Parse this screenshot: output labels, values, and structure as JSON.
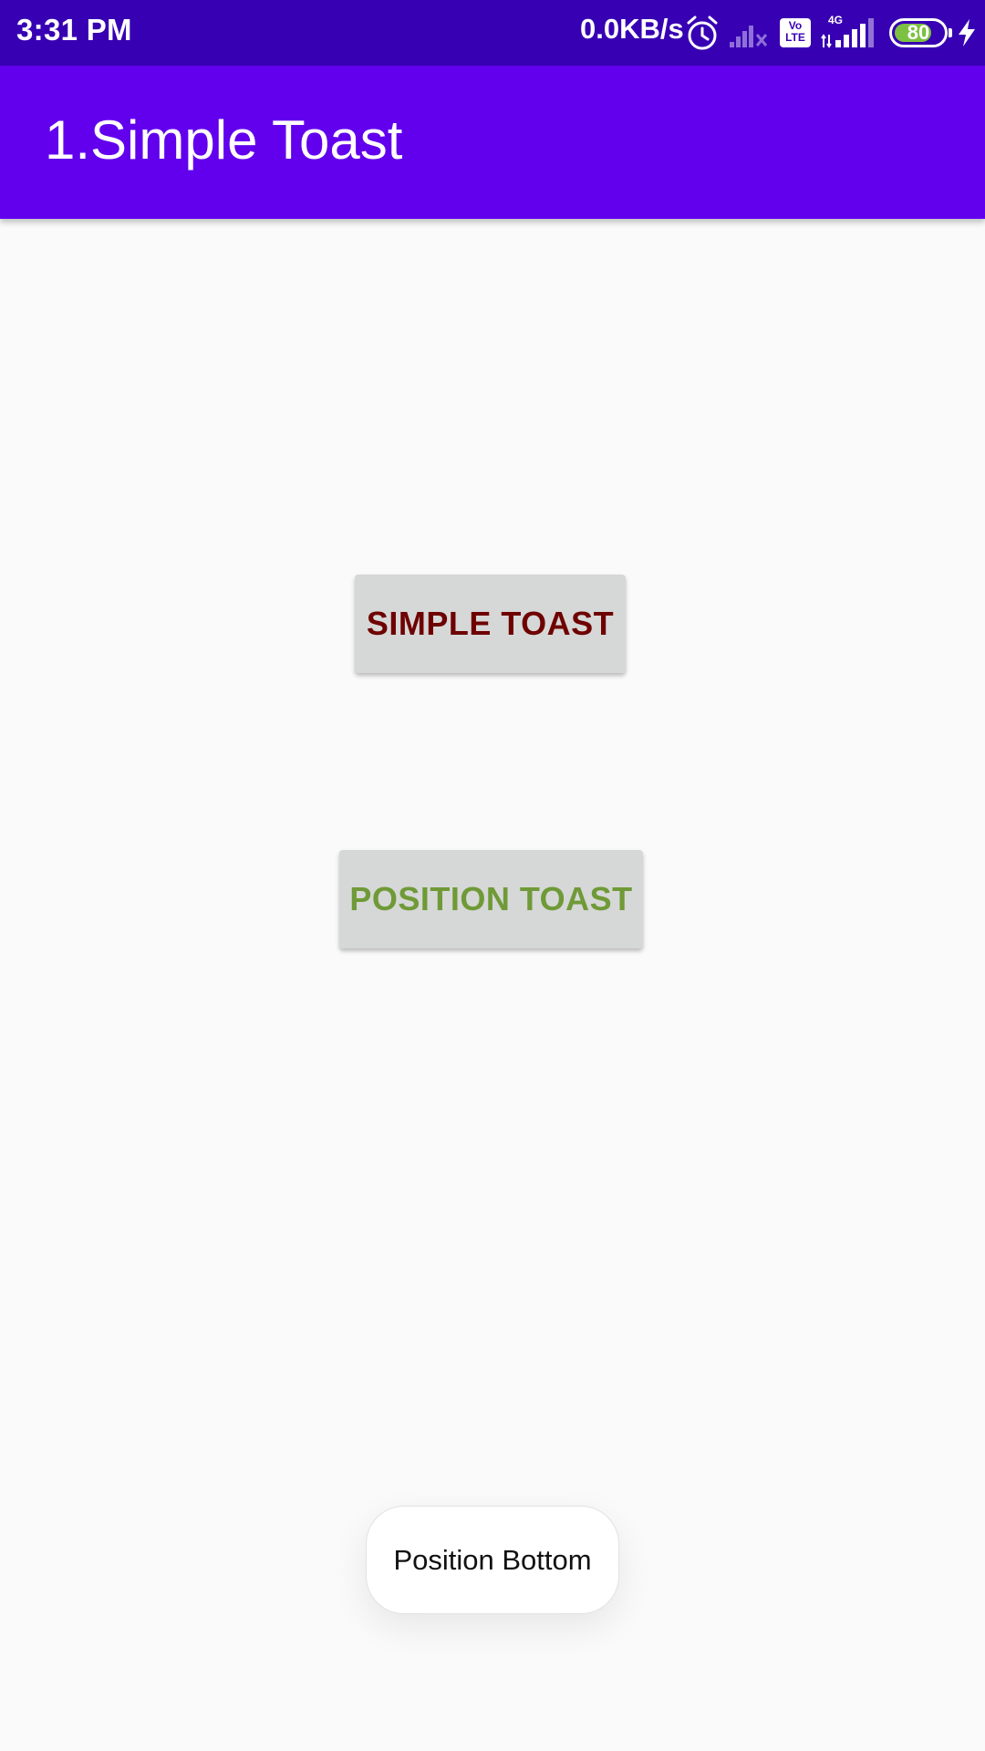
{
  "status_bar": {
    "time": "3:31 PM",
    "network_speed": "0.0KB/s",
    "icons": [
      "alarm-icon",
      "no-sim-signal-icon",
      "volte-icon",
      "4g-signal-icon",
      "battery-icon",
      "charging-bolt-icon"
    ],
    "volte_label_top": "Vo",
    "volte_label_bottom": "LTE",
    "network_type": "4G",
    "battery_level": "80",
    "battery_fraction": 0.8
  },
  "app_bar": {
    "title": "1.Simple Toast"
  },
  "buttons": {
    "simple_toast_label": "SIMPLE TOAST",
    "position_toast_label": "POSITION TOAST"
  },
  "toast": {
    "message": "Position Bottom"
  },
  "colors": {
    "status_bar": "#3700B3",
    "app_bar": "#6200EE",
    "background": "#FAFAFA",
    "button_bg": "#D6D7D7",
    "simple_toast_text": "#6E0000",
    "position_toast_text": "#6F9A37",
    "battery_fill": "#7CC142"
  }
}
